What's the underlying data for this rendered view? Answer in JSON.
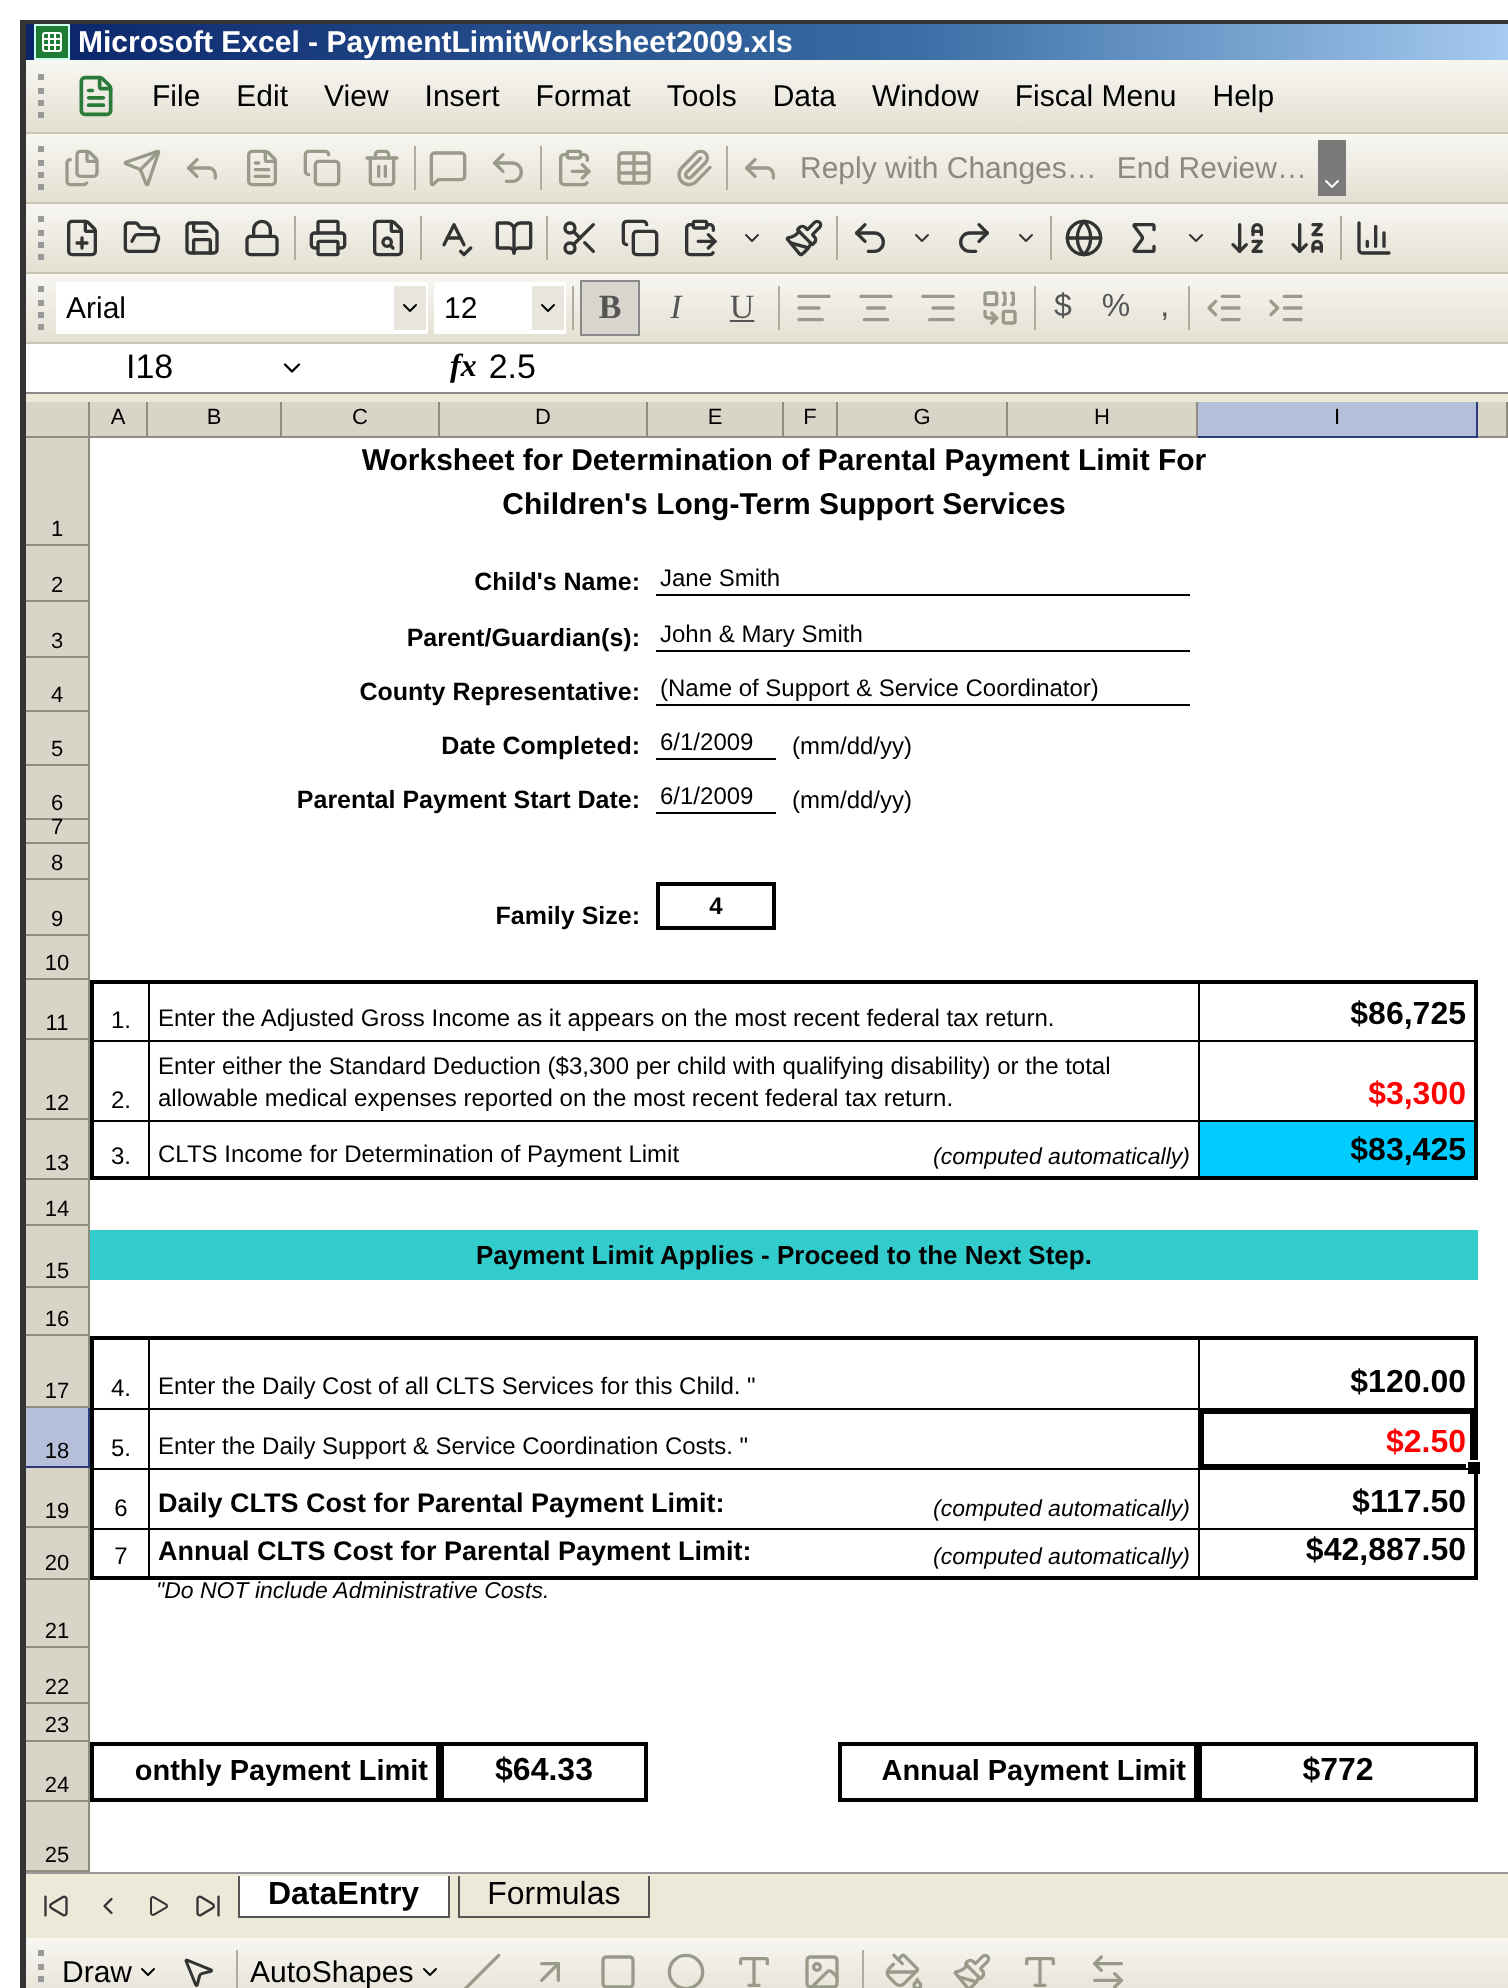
{
  "window": {
    "title": "Microsoft Excel - PaymentLimitWorksheet2009.xls"
  },
  "menu": [
    "File",
    "Edit",
    "View",
    "Insert",
    "Format",
    "Tools",
    "Data",
    "Window",
    "Fiscal Menu",
    "Help"
  ],
  "review_toolbar": {
    "actions": [
      "Reply with Changes…",
      "End Review…"
    ]
  },
  "format_toolbar": {
    "font": "Arial",
    "size": "12",
    "buttons": [
      {
        "label": "B",
        "kind": "bold",
        "pressed": true
      },
      {
        "label": "I",
        "kind": "italic",
        "pressed": false
      },
      {
        "label": "U",
        "kind": "underline",
        "pressed": false
      }
    ],
    "number_buttons": [
      "$",
      "%",
      ","
    ]
  },
  "formula_bar": {
    "name_box": "I18",
    "fx": "fx",
    "formula": "2.5"
  },
  "columns": [
    {
      "label": "A",
      "selected": false
    },
    {
      "label": "B",
      "selected": false
    },
    {
      "label": "C",
      "selected": false
    },
    {
      "label": "D",
      "selected": false
    },
    {
      "label": "E",
      "selected": false
    },
    {
      "label": "F",
      "selected": false
    },
    {
      "label": "G",
      "selected": false
    },
    {
      "label": "H",
      "selected": false
    },
    {
      "label": "I",
      "selected": true
    }
  ],
  "rows": [
    {
      "label": "1",
      "selected": false
    },
    {
      "label": "2",
      "selected": false
    },
    {
      "label": "3",
      "selected": false
    },
    {
      "label": "4",
      "selected": false
    },
    {
      "label": "5",
      "selected": false
    },
    {
      "label": "6",
      "selected": false
    },
    {
      "label": "7",
      "selected": false
    },
    {
      "label": "8",
      "selected": false
    },
    {
      "label": "9",
      "selected": false
    },
    {
      "label": "10",
      "selected": false
    },
    {
      "label": "11",
      "selected": false
    },
    {
      "label": "12",
      "selected": false
    },
    {
      "label": "13",
      "selected": false
    },
    {
      "label": "14",
      "selected": false
    },
    {
      "label": "15",
      "selected": false
    },
    {
      "label": "16",
      "selected": false
    },
    {
      "label": "17",
      "selected": false
    },
    {
      "label": "18",
      "selected": true
    },
    {
      "label": "19",
      "selected": false
    },
    {
      "label": "20",
      "selected": false
    },
    {
      "label": "21",
      "selected": false
    },
    {
      "label": "22",
      "selected": false
    },
    {
      "label": "23",
      "selected": false
    },
    {
      "label": "24",
      "selected": false
    },
    {
      "label": "25",
      "selected": false
    }
  ],
  "sheet": {
    "title": [
      "Worksheet for Determination of Parental Payment Limit For",
      "Children's Long-Term Support Services"
    ],
    "fields": [
      {
        "label": "Child's Name:",
        "value": "Jane Smith",
        "kind": "long"
      },
      {
        "label": "Parent/Guardian(s):",
        "value": "John & Mary Smith",
        "kind": "long"
      },
      {
        "label": "County Representative:",
        "value": "(Name of Support & Service Coordinator)",
        "kind": "long"
      },
      {
        "label": "Date Completed:",
        "value": "6/1/2009",
        "kind": "date",
        "note": "(mm/dd/yy)"
      },
      {
        "label": "Parental Payment Start Date:",
        "value": "6/1/2009",
        "kind": "date",
        "note": "(mm/dd/yy)"
      }
    ],
    "family_size": {
      "label": "Family Size:",
      "value": "4"
    },
    "income_steps": [
      {
        "number": "1.",
        "text": "Enter the Adjusted Gross Income as it appears on the most recent federal tax return.",
        "value": "$86,725",
        "entered": false,
        "highlighted": false,
        "bold": false,
        "selected": false
      },
      {
        "number": "2.",
        "text": "Enter either the Standard Deduction ($3,300 per child with qualifying disability) or the total allowable medical expenses reported on the most recent federal tax return.",
        "value": "$3,300",
        "entered": true,
        "highlighted": false,
        "bold": false,
        "selected": false
      },
      {
        "number": "3.",
        "text": "CLTS Income for Determination of Payment Limit",
        "note": "(computed automatically)",
        "value": "$83,425",
        "entered": false,
        "highlighted": true,
        "bold": false,
        "selected": false
      }
    ],
    "banner": "Payment Limit Applies - Proceed to the Next Step.",
    "cost_steps": [
      {
        "number": "4.",
        "text": "Enter the Daily Cost of all CLTS Services for this Child. \"",
        "value": "$120.00",
        "entered": false,
        "highlighted": false,
        "bold": false,
        "selected": false
      },
      {
        "number": "5.",
        "text": "Enter the Daily Support & Service Coordination Costs. \"",
        "value": "$2.50",
        "entered": true,
        "highlighted": false,
        "bold": false,
        "selected": true
      },
      {
        "number": "6",
        "text": "Daily CLTS Cost for Parental Payment Limit:",
        "note": "(computed automatically)",
        "value": "$117.50",
        "entered": false,
        "highlighted": false,
        "bold": true,
        "selected": false
      },
      {
        "number": "7",
        "text": "Annual CLTS Cost for Parental Payment Limit:",
        "note": "(computed automatically)",
        "value": "$42,887.50",
        "entered": false,
        "highlighted": false,
        "bold": true,
        "selected": false
      }
    ],
    "footnote": "\"Do NOT include Administrative Costs.",
    "limits": [
      {
        "label": "onthly Payment Limit",
        "value": "$64.33"
      },
      {
        "label": "Annual Payment Limit",
        "value": "$772"
      }
    ]
  },
  "sheet_tabs": [
    {
      "label": "DataEntry",
      "selected": true
    },
    {
      "label": "Formulas",
      "selected": false
    }
  ],
  "draw_toolbar": [
    "Draw",
    "AutoShapes"
  ]
}
